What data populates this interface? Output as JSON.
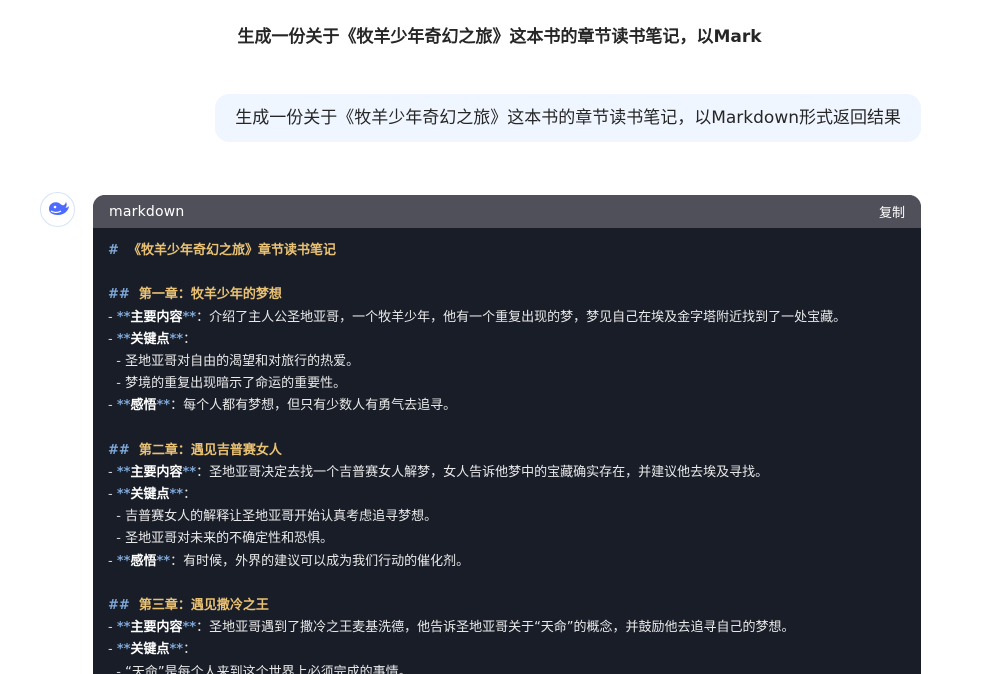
{
  "conversation": {
    "title": "生成一份关于《牧羊少年奇幻之旅》这本书的章节读书笔记，以Mark"
  },
  "user_message": {
    "text": "生成一份关于《牧羊少年奇幻之旅》这本书的章节读书笔记，以Markdown形式返回结果"
  },
  "assistant": {
    "avatar_icon": "whale-logo-icon",
    "brand_color": "#4d6bfe"
  },
  "code_block": {
    "language": "markdown",
    "copy_label": "复制",
    "lines": [
      {
        "type": "h1",
        "mark": "#",
        "text": "《牧羊少年奇幻之旅》章节读书笔记"
      },
      {
        "type": "blank"
      },
      {
        "type": "h2",
        "mark": "##",
        "text": "第一章：牧羊少年的梦想"
      },
      {
        "type": "item",
        "indent": 0,
        "bold": "主要内容",
        "text": "：介绍了主人公圣地亚哥，一个牧羊少年，他有一个重复出现的梦，梦见自己在埃及金字塔附近找到了一处宝藏。"
      },
      {
        "type": "item",
        "indent": 0,
        "bold": "关键点",
        "text": "："
      },
      {
        "type": "sub",
        "indent": 1,
        "text": "圣地亚哥对自由的渴望和对旅行的热爱。"
      },
      {
        "type": "sub",
        "indent": 1,
        "text": "梦境的重复出现暗示了命运的重要性。"
      },
      {
        "type": "item",
        "indent": 0,
        "bold": "感悟",
        "text": "：每个人都有梦想，但只有少数人有勇气去追寻。"
      },
      {
        "type": "blank"
      },
      {
        "type": "h2",
        "mark": "##",
        "text": "第二章：遇见吉普赛女人"
      },
      {
        "type": "item",
        "indent": 0,
        "bold": "主要内容",
        "text": "：圣地亚哥决定去找一个吉普赛女人解梦，女人告诉他梦中的宝藏确实存在，并建议他去埃及寻找。"
      },
      {
        "type": "item",
        "indent": 0,
        "bold": "关键点",
        "text": "："
      },
      {
        "type": "sub",
        "indent": 1,
        "text": "吉普赛女人的解释让圣地亚哥开始认真考虑追寻梦想。"
      },
      {
        "type": "sub",
        "indent": 1,
        "text": "圣地亚哥对未来的不确定性和恐惧。"
      },
      {
        "type": "item",
        "indent": 0,
        "bold": "感悟",
        "text": "：有时候，外界的建议可以成为我们行动的催化剂。"
      },
      {
        "type": "blank"
      },
      {
        "type": "h2",
        "mark": "##",
        "text": "第三章：遇见撒冷之王"
      },
      {
        "type": "item",
        "indent": 0,
        "bold": "主要内容",
        "text": "：圣地亚哥遇到了撒冷之王麦基洗德，他告诉圣地亚哥关于“天命”的概念，并鼓励他去追寻自己的梦想。"
      },
      {
        "type": "item",
        "indent": 0,
        "bold": "关键点",
        "text": "："
      },
      {
        "type": "sub",
        "indent": 1,
        "text": "“天命”是每个人来到这个世界上必须完成的事情。"
      }
    ]
  }
}
